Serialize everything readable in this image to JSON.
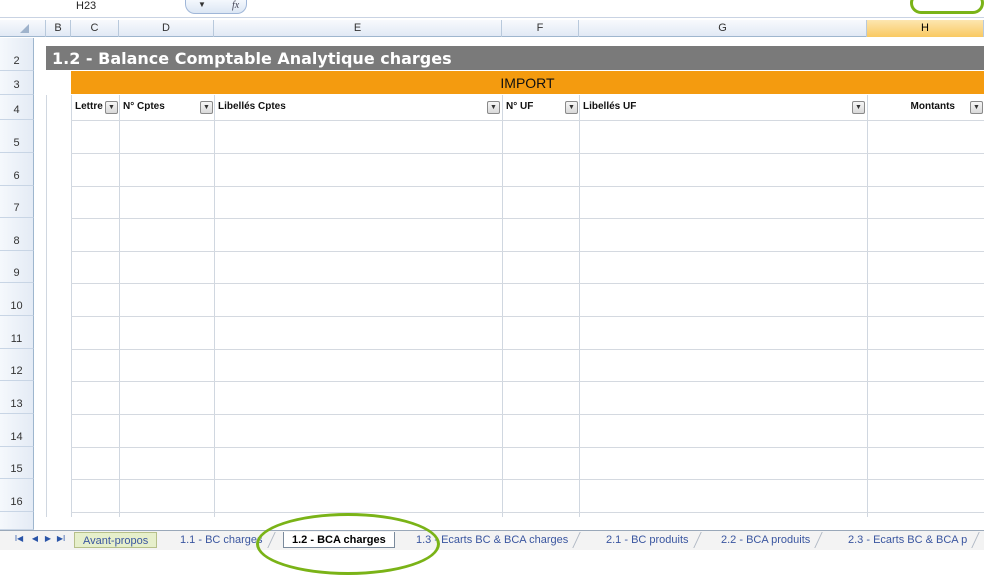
{
  "formula_bar": {
    "name_box": "H23",
    "fx": "fx"
  },
  "columns": [
    "B",
    "C",
    "D",
    "E",
    "F",
    "G",
    "H"
  ],
  "rows": [
    "2",
    "3",
    "4",
    "5",
    "6",
    "7",
    "8",
    "9",
    "10",
    "11",
    "12",
    "13",
    "14",
    "15",
    "16"
  ],
  "sheet": {
    "title": "1.2 - Balance Comptable Analytique charges",
    "section": "IMPORT",
    "headers": [
      "Lettre",
      "N° Cptes",
      "Libellés Cptes",
      "N° UF",
      "Libellés UF",
      "Montants"
    ]
  },
  "tabs": {
    "items": [
      "Avant-propos",
      "1.1 - BC charges",
      "1.2 - BCA charges",
      "1.3 - Ecarts BC & BCA charges",
      "2.1 - BC produits",
      "2.2 - BCA produits",
      "2.3 - Ecarts BC & BCA p"
    ],
    "active": "1.2 - BCA charges"
  },
  "colors": {
    "title_band": "#7a7a7a",
    "import_band": "#f49b0f",
    "highlight": "#7ab317"
  },
  "icons": [
    "first-sheet-icon",
    "prev-sheet-icon",
    "next-sheet-icon",
    "last-sheet-icon",
    "dropdown-arrow-icon"
  ]
}
